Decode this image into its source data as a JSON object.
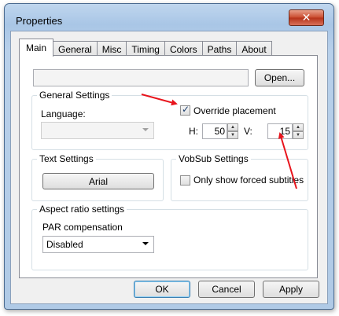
{
  "window": {
    "title": "Properties",
    "close_symbol": "✕"
  },
  "tabs": [
    "Main",
    "General",
    "Misc",
    "Timing",
    "Colors",
    "Paths",
    "About"
  ],
  "file": {
    "path_value": "",
    "open_label": "Open..."
  },
  "general_settings": {
    "title": "General Settings",
    "language_label": "Language:",
    "language_value": "",
    "override_label": "Override placement",
    "override_checked": true,
    "h_label": "H:",
    "h_value": "50",
    "v_label": "V:",
    "v_value": "15"
  },
  "text_settings": {
    "title": "Text Settings",
    "font_button": "Arial"
  },
  "vobsub_settings": {
    "title": "VobSub Settings",
    "forced_label": "Only show forced subtitles",
    "forced_checked": false
  },
  "aspect_ratio": {
    "title": "Aspect ratio settings",
    "par_label": "PAR compensation",
    "par_value": "Disabled"
  },
  "buttons": {
    "ok": "OK",
    "cancel": "Cancel",
    "apply": "Apply"
  },
  "colors": {
    "arrow": "#e8141c",
    "title_bar": "#b8d0ea"
  }
}
